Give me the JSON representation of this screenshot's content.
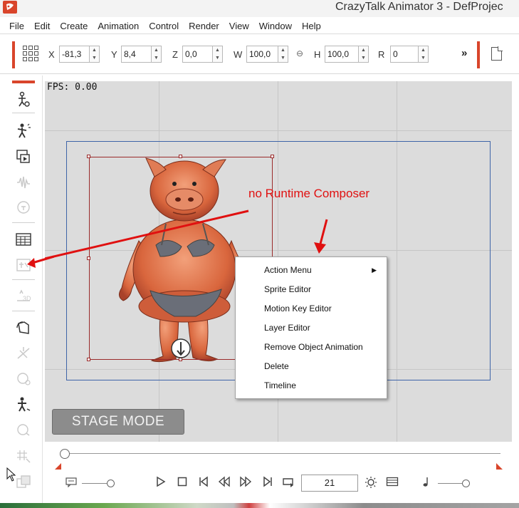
{
  "window": {
    "title": "CrazyTalk Animator 3   - DefProjec",
    "app_icon": "crazytalk-logo"
  },
  "menu": [
    "File",
    "Edit",
    "Create",
    "Animation",
    "Control",
    "Render",
    "View",
    "Window",
    "Help"
  ],
  "transform": {
    "x_label": "X",
    "x_value": "-81,3",
    "y_label": "Y",
    "y_value": "8,4",
    "z_label": "Z",
    "z_value": "0,0",
    "w_label": "W",
    "w_value": "100,0",
    "h_label": "H",
    "h_value": "100,0",
    "r_label": "R",
    "r_value": "0",
    "more": "»"
  },
  "left_tools": [
    {
      "icon": "actor-settings-icon",
      "enabled": true
    },
    {
      "icon": "puppet-icon",
      "enabled": true
    },
    {
      "icon": "sprite-editor-icon",
      "enabled": true
    },
    {
      "icon": "audio-wave-icon",
      "enabled": false
    },
    {
      "icon": "speech-icon",
      "enabled": false
    },
    {
      "icon": "timeline-panel-icon",
      "enabled": true
    },
    {
      "icon": "runtime-composer-icon",
      "enabled": false
    },
    {
      "icon": "3d-head-icon",
      "enabled": false
    },
    {
      "icon": "flip-icon",
      "enabled": true
    },
    {
      "icon": "bone-icon",
      "enabled": false
    },
    {
      "icon": "face-key-icon",
      "enabled": false
    },
    {
      "icon": "motion-pose-icon",
      "enabled": true
    },
    {
      "icon": "head-rotate-icon",
      "enabled": false
    },
    {
      "icon": "deform-grid-icon",
      "enabled": false
    },
    {
      "icon": "layer-icon",
      "enabled": false
    }
  ],
  "stage": {
    "fps_text": "FPS: 0.00",
    "annotation": "no Runtime Composer",
    "mode_button": "STAGE MODE"
  },
  "context_menu": {
    "items": [
      "Action Menu",
      "Sprite Editor",
      "Motion Key Editor",
      "Layer Editor",
      "Remove Object Animation",
      "Delete",
      "Timeline"
    ]
  },
  "playback": {
    "frame": "21",
    "transport_icons": [
      "play-icon",
      "stop-icon",
      "previous-key-icon",
      "step-back-icon",
      "step-forward-icon",
      "next-key-icon",
      "loop-icon"
    ]
  },
  "colors": {
    "accent": "#d9452b",
    "annotation": "#e01010",
    "camera_frame": "#3e64a8",
    "selection": "#9a2a2a"
  }
}
